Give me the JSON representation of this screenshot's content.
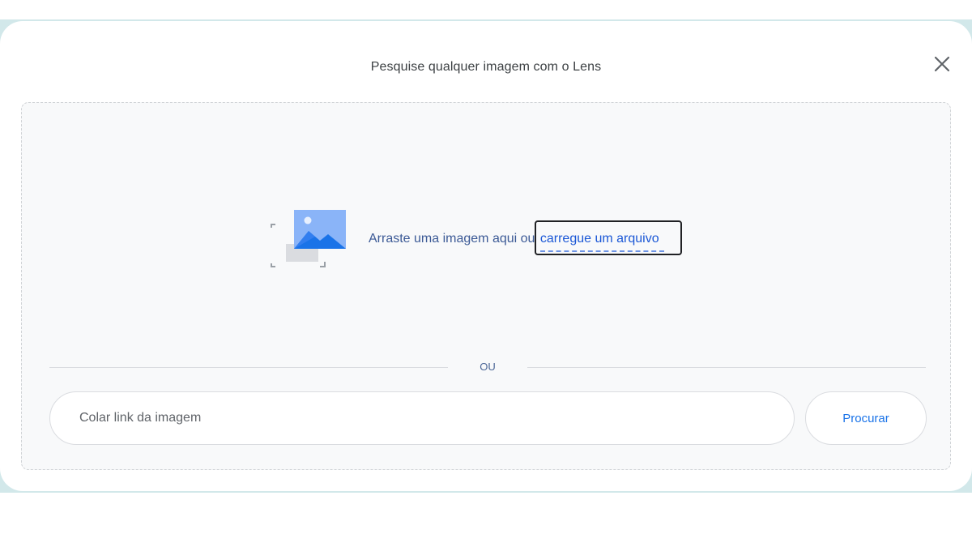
{
  "dialog": {
    "title": "Pesquise qualquer imagem com o Lens",
    "close_icon": "close-icon"
  },
  "dropzone": {
    "illustration_icon": "image-placeholder-icon",
    "text_prefix": "Arraste uma imagem aqui ou ",
    "upload_link": "carregue um arquivo"
  },
  "divider": {
    "label": "OU"
  },
  "url_search": {
    "placeholder": "Colar link da imagem",
    "value": "",
    "button_label": "Procurar"
  },
  "colors": {
    "accent": "#1a73e8",
    "link": "#1a57d6",
    "backdrop": "#d2e8ea",
    "dropzone_bg": "#f8f9fa"
  }
}
